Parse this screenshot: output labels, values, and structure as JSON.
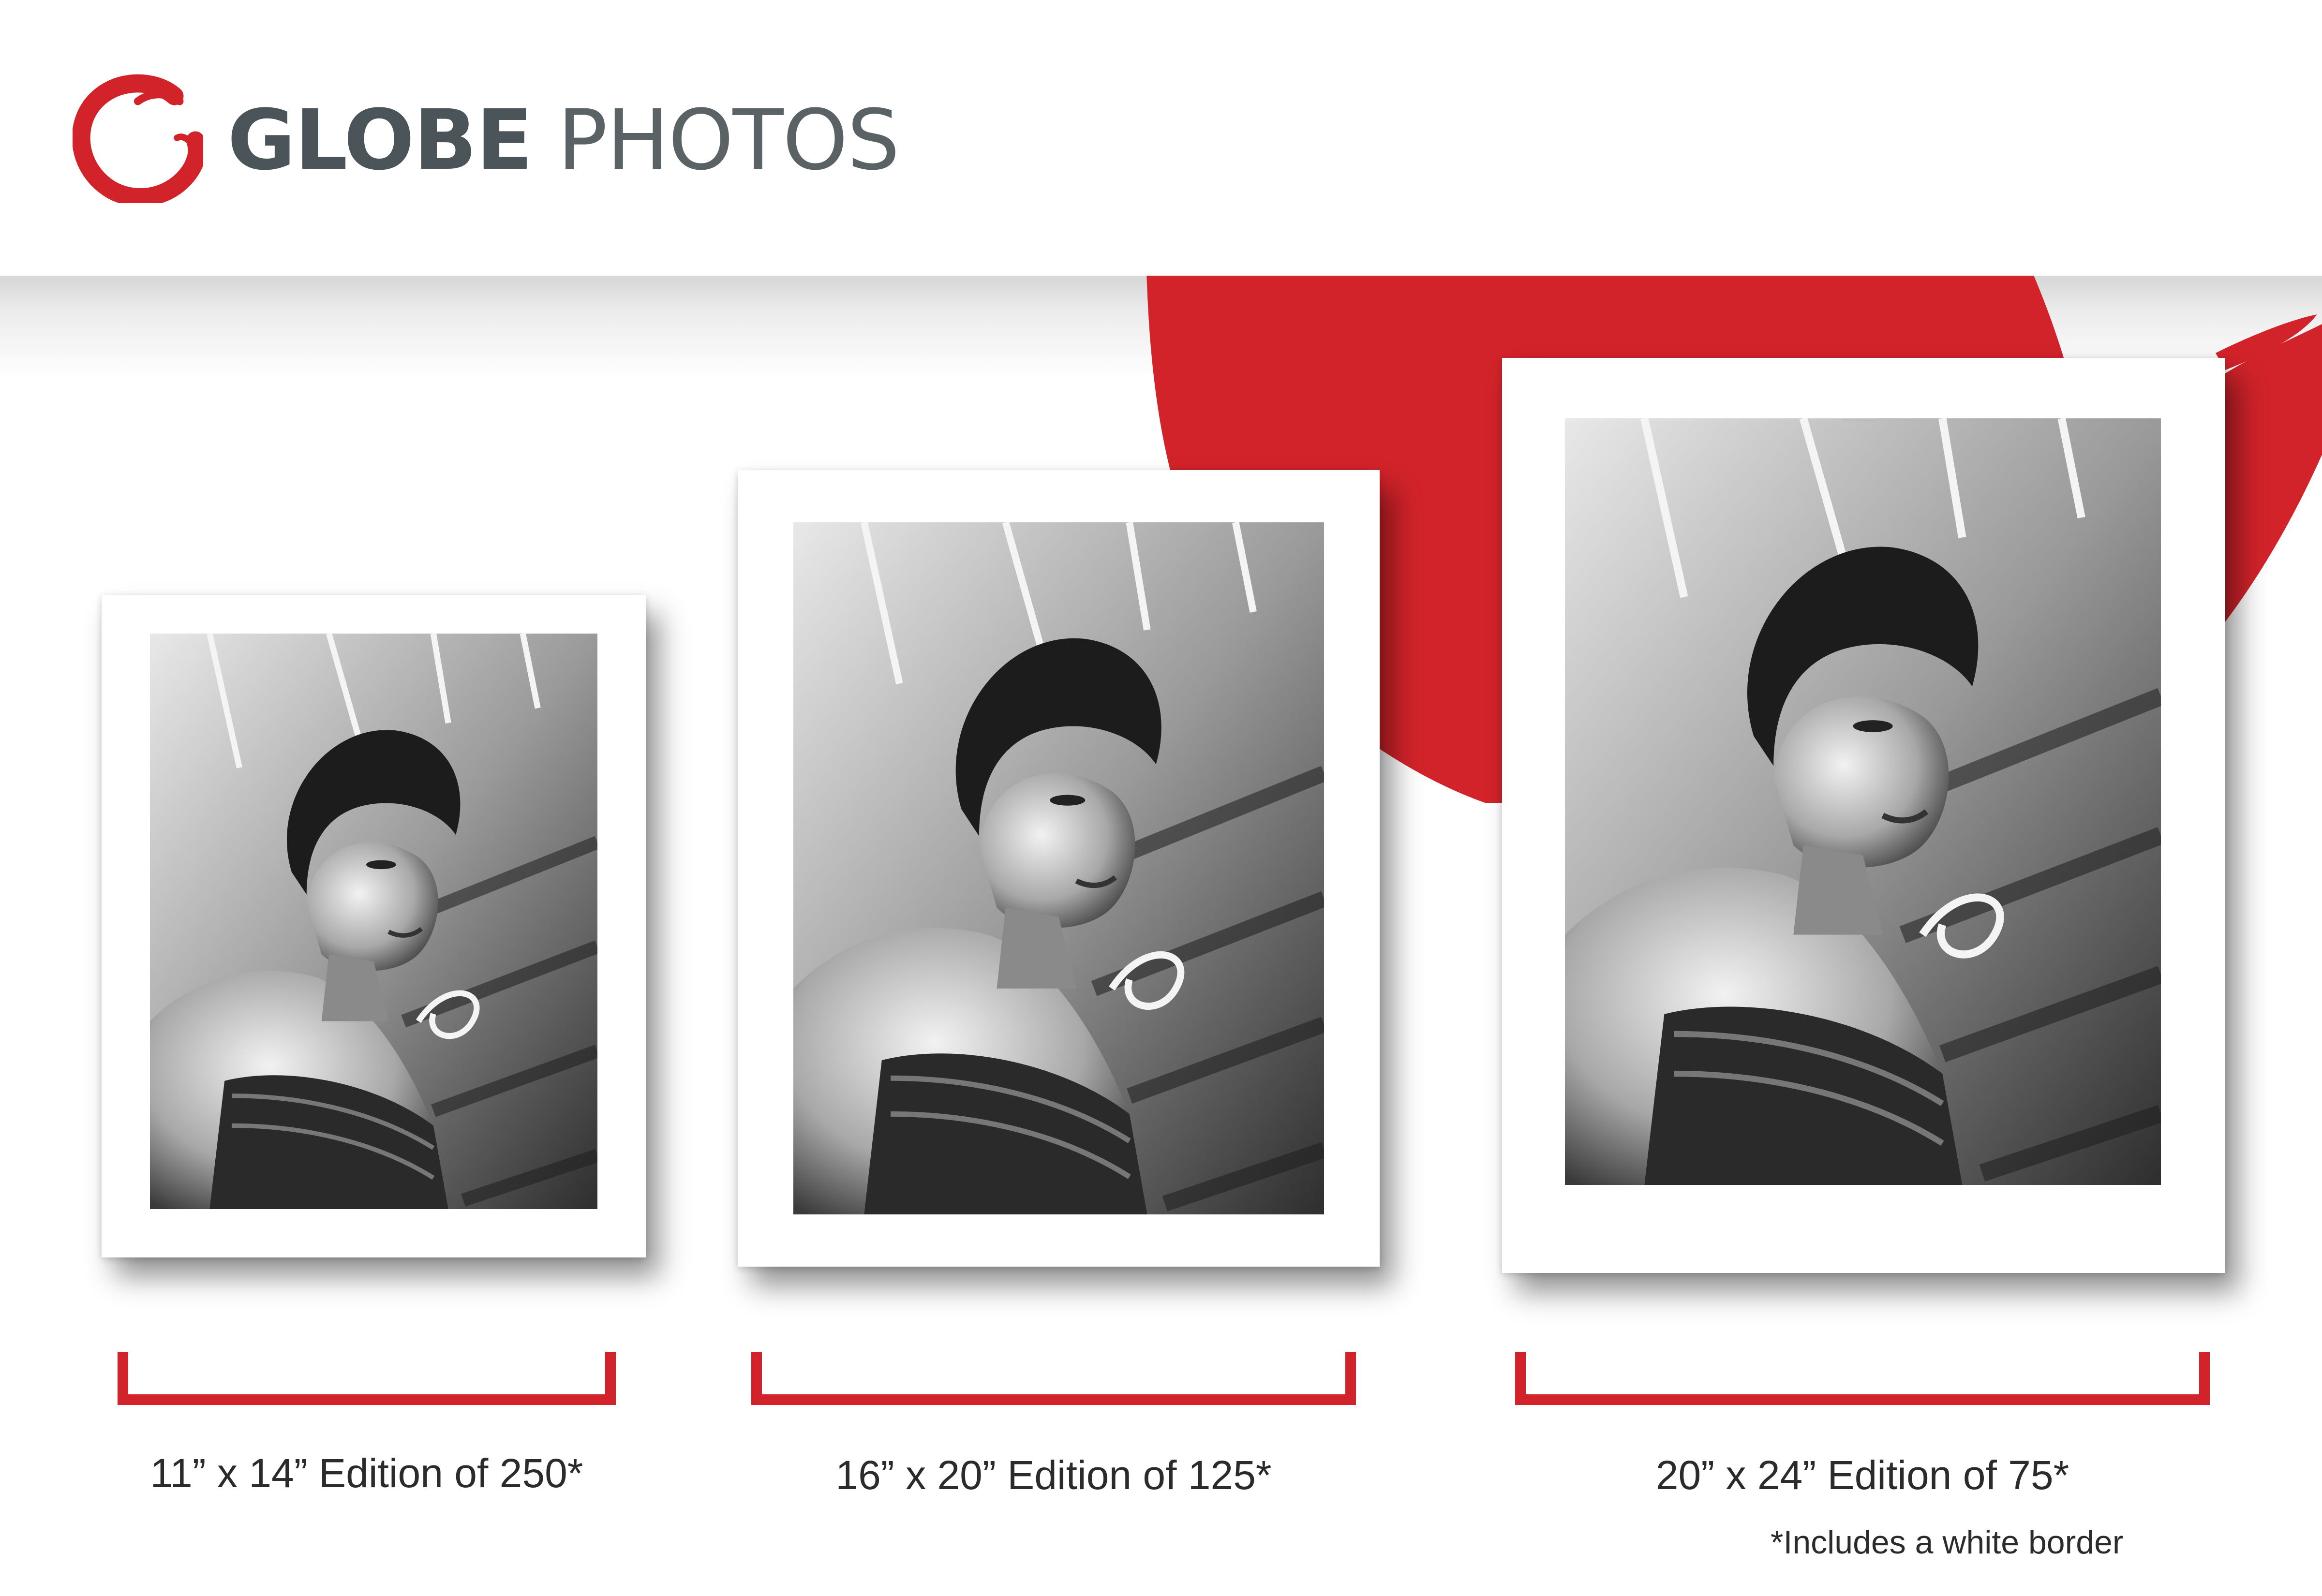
{
  "brand": {
    "name_bold": "GLOBE",
    "name_light": "PHOTOS",
    "logo_icon": "brush-circle-logo",
    "colors": {
      "accent": "#d2232a",
      "text": "#4b5459"
    }
  },
  "editions": [
    {
      "size": "11” x 14”",
      "label": "11” x 14” Edition of 250*",
      "edition_count": 250
    },
    {
      "size": "16” x 20”",
      "label": "16” x 20” Edition of 125*",
      "edition_count": 125
    },
    {
      "size": "20” x 24”",
      "label": "20” x 24” Edition of 75*",
      "edition_count": 75
    }
  ],
  "footnote": "*Includes a white border"
}
